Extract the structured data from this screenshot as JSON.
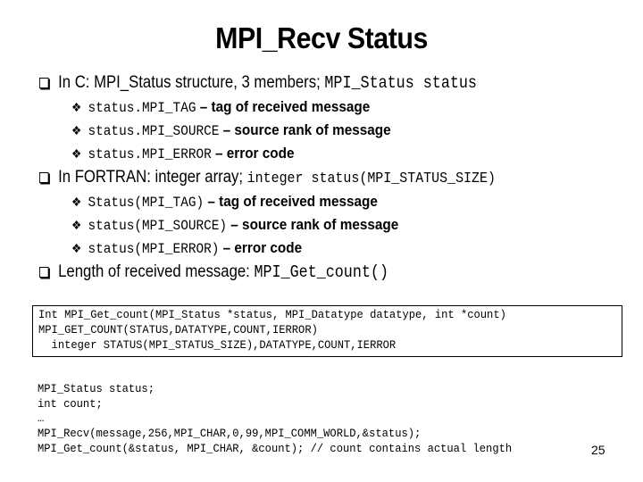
{
  "slide": {
    "title": "MPI_Recv Status",
    "slide_number": "25",
    "bullets": [
      {
        "text": "In C: MPI_Status structure, 3 members; ",
        "code": "MPI_Status status",
        "sub": [
          {
            "code": "status.MPI_TAG",
            "text": " – tag of received message"
          },
          {
            "code": "status.MPI_SOURCE",
            "text": " – source rank of message"
          },
          {
            "code": "status.MPI_ERROR",
            "text": " – error code"
          }
        ]
      },
      {
        "text": "In FORTRAN: integer array; ",
        "code": "integer status(MPI_STATUS_SIZE)",
        "sub": [
          {
            "code": "Status(MPI_TAG)",
            "text": " – tag of received message"
          },
          {
            "code": "status(MPI_SOURCE)",
            "text": " – source rank of message"
          },
          {
            "code": "status(MPI_ERROR)",
            "text": " – error code"
          }
        ]
      },
      {
        "text": "Length of received message: ",
        "code": "MPI_Get_count()"
      }
    ],
    "signature_box": [
      "Int MPI_Get_count(MPI_Status *status, MPI_Datatype datatype, int *count)",
      "MPI_GET_COUNT(STATUS,DATATYPE,COUNT,IERROR)",
      "  integer STATUS(MPI_STATUS_SIZE),DATATYPE,COUNT,IERROR"
    ],
    "example_code": [
      "MPI_Status status;",
      "int count;",
      "…",
      "MPI_Recv(message,256,MPI_CHAR,0,99,MPI_COMM_WORLD,&status);",
      "MPI_Get_count(&status, MPI_CHAR, &count); // count contains actual length"
    ]
  }
}
